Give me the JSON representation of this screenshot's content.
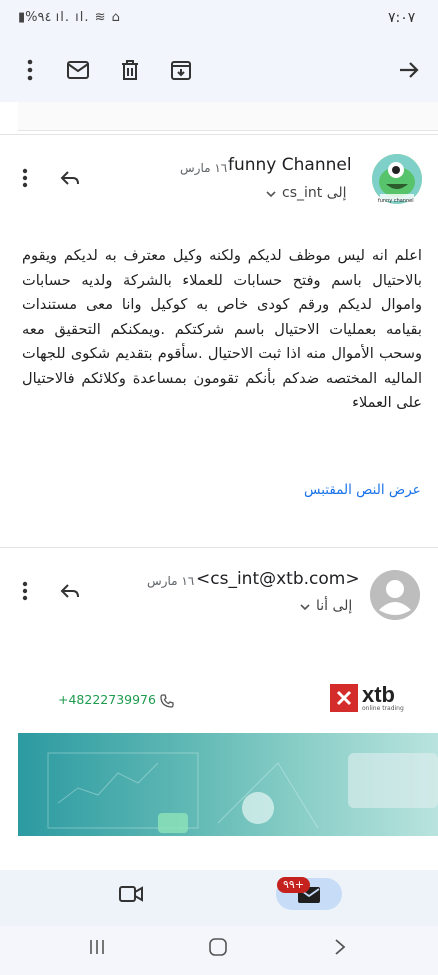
{
  "status_bar": {
    "time": "٧:٠٧",
    "indicators": "▮%٩٤ ıl. ıl. ≋ ⌂"
  },
  "toolbar": {
    "icons": [
      "more-vert-icon",
      "mail-icon",
      "delete-icon",
      "archive-icon",
      "forward-arrow-icon"
    ]
  },
  "messages": [
    {
      "sender": "funny Channel",
      "date": "١٦ مارس",
      "recipient": "إلى cs_int",
      "avatar_caption": "funny channel",
      "body": "اعلم انه ليس موظف لديكم ولكنه وكيل معترف به لديكم ويقوم بالاحتيال باسم وفتح حسابات للعملاء بالشركة ولديه حسابات واموال لديكم ورقم كودى خاص به كوكيل وانا معى مستندات بقيامه بعمليات الاحتيال باسم شركتكم .ويمكنكم التحقيق معه وسحب الأموال منه اذا ثبت الاحتيال .سأقوم بتقديم شكوى للجهات الماليه المختصه ضدكم بأنكم تقومون بمساعدة وكلائكم فالاحتيال على العملاء",
      "show_quoted": "عرض النص المقتبس"
    },
    {
      "sender": "<cs_int@xtb.com>",
      "date": "١٦ مارس",
      "recipient": "إلى أنا",
      "promo": {
        "phone": "+48222739976",
        "brand": "xtb",
        "brand_sub": "online trading"
      }
    }
  ],
  "bottom_nav": {
    "badge": "٩٩+"
  },
  "colors": {
    "accent": "#1a73e8",
    "brand_red": "#d42b2b",
    "phone_green": "#1e9b4e"
  }
}
